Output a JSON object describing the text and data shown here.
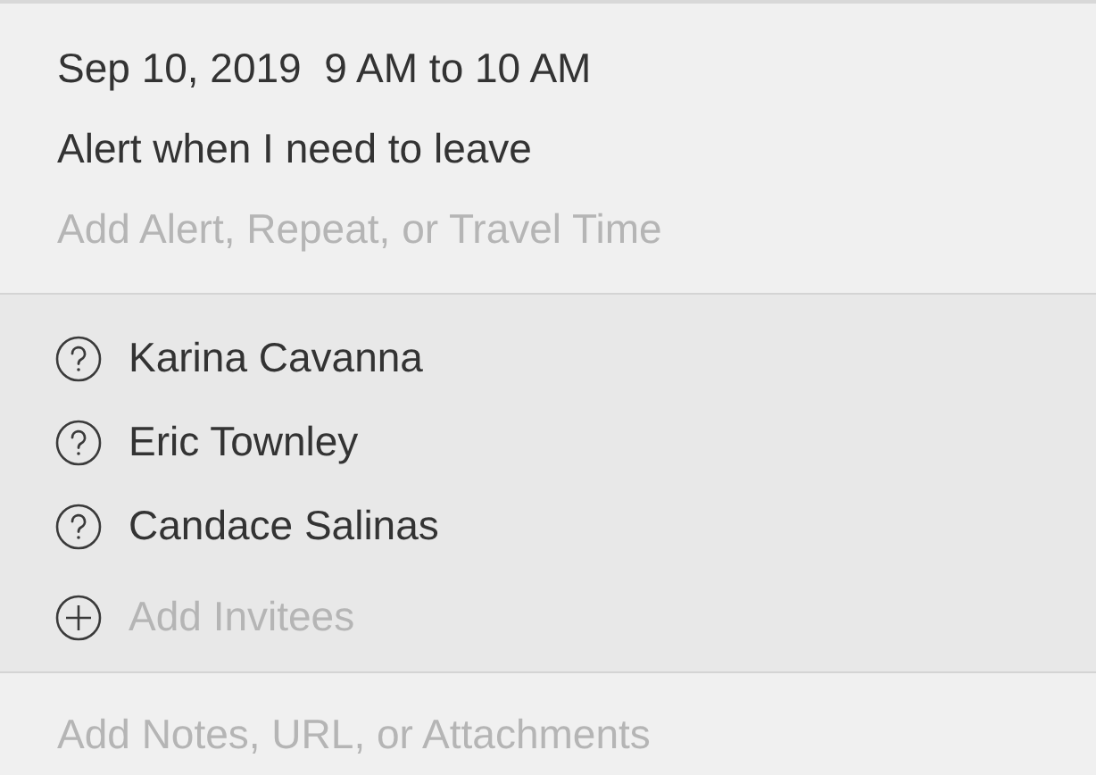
{
  "event": {
    "date": "Sep 10, 2019",
    "time": "9 AM to 10 AM",
    "alert": "Alert when I need to leave",
    "add_placeholder": "Add Alert, Repeat, or Travel Time"
  },
  "invitees": [
    {
      "name": "Karina Cavanna",
      "kind": "pending"
    },
    {
      "name": "Eric Townley",
      "kind": "pending"
    },
    {
      "name": "Candace Salinas",
      "kind": "pending"
    }
  ],
  "add_invitees": {
    "placeholder": "Add Invitees"
  },
  "notes": {
    "placeholder": "Add Notes, URL, or Attachments"
  }
}
